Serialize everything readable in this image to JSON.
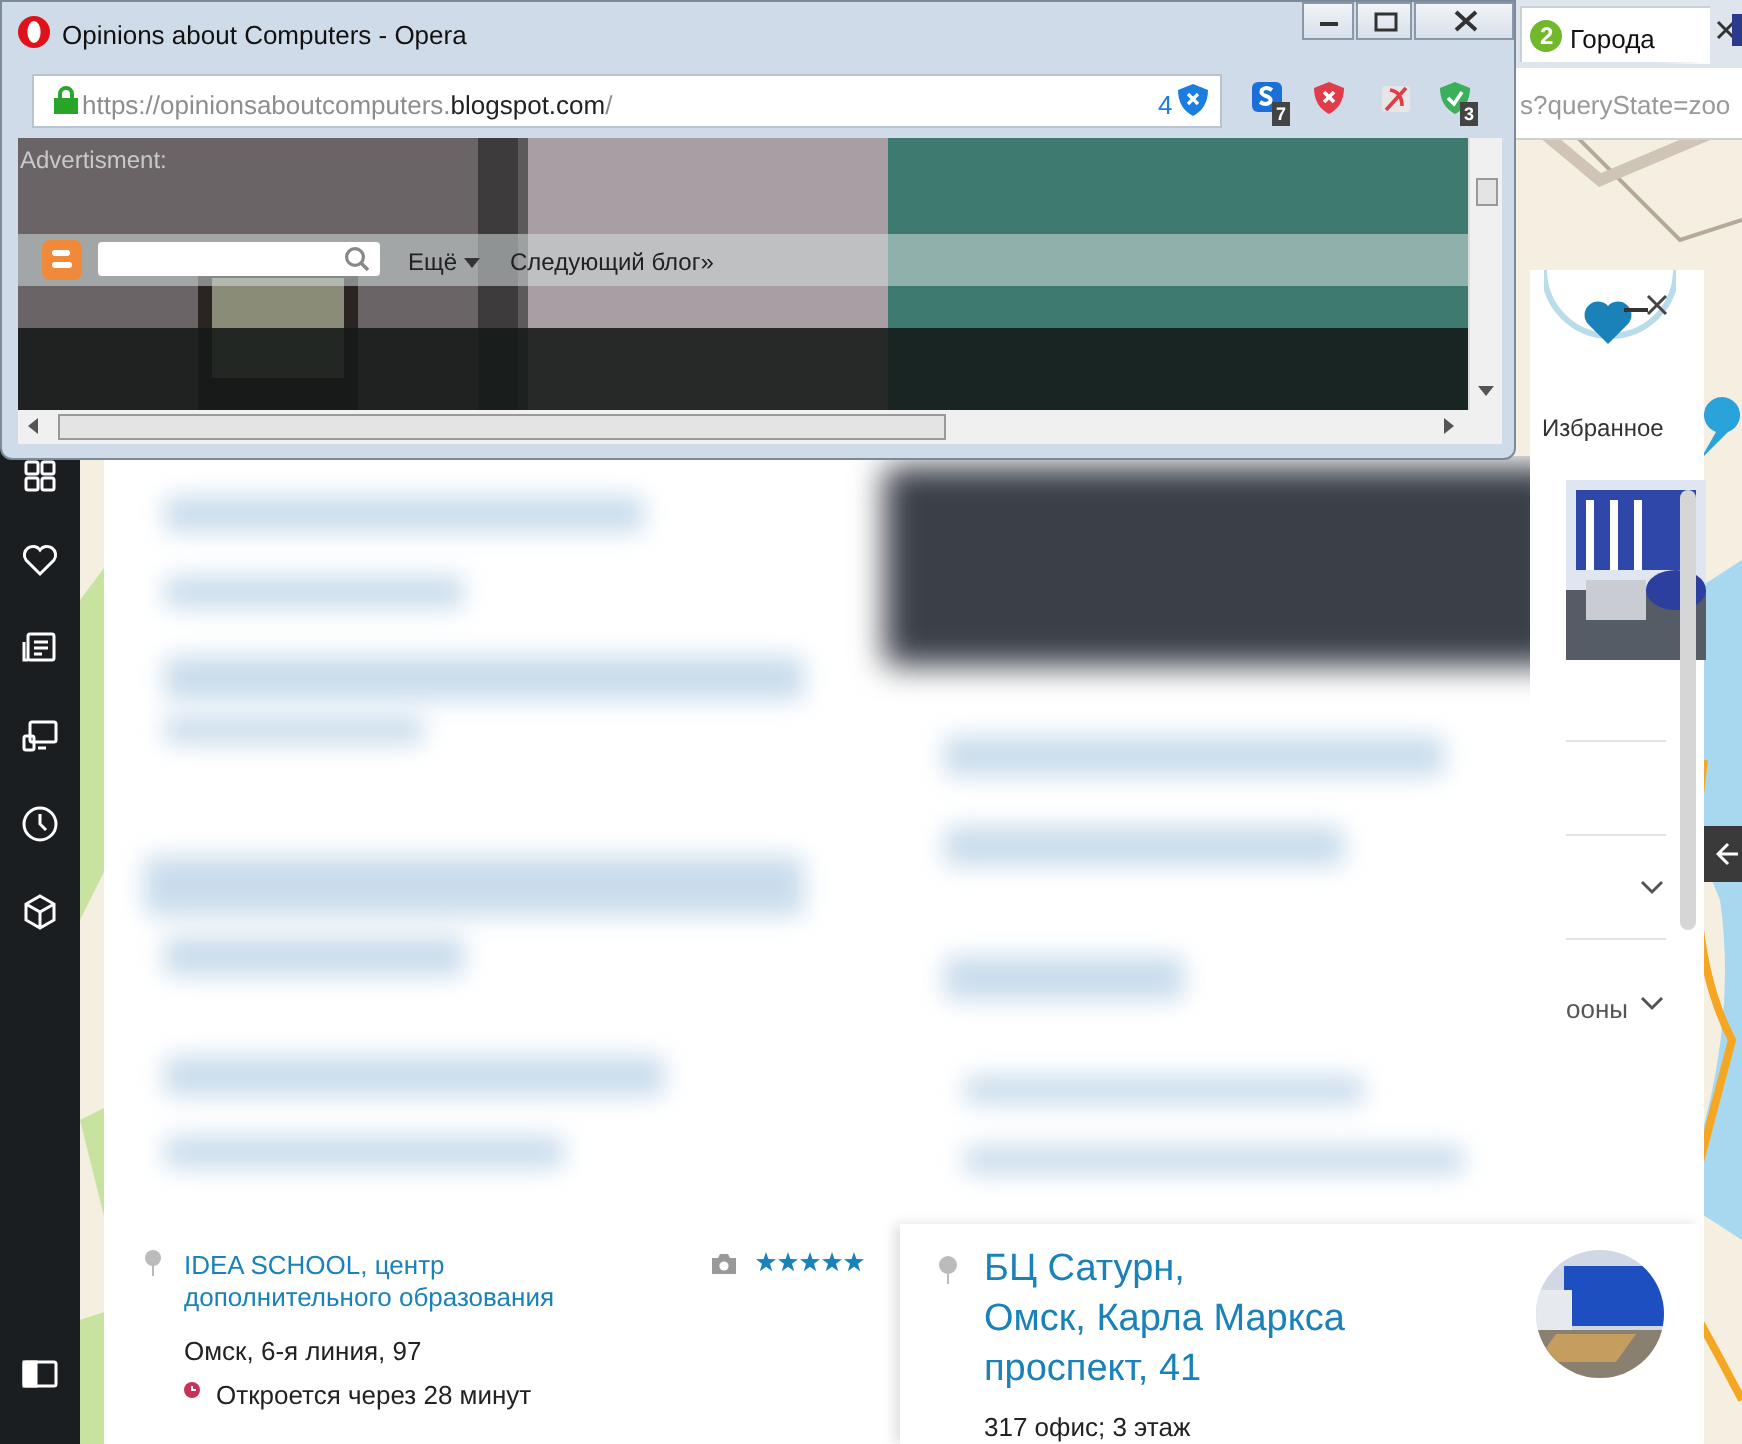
{
  "popup_window": {
    "title": "Opinions about Computers - Opera",
    "url": [
      {
        "text": "https://opinionsaboutcomputers.",
        "emphasis": false
      },
      {
        "text": "blogspot.com",
        "emphasis": true
      },
      {
        "text": "/",
        "emphasis": false
      }
    ],
    "blocked_count": "4",
    "extensions": [
      {
        "kind": "s",
        "badge": "7"
      },
      {
        "kind": "block"
      },
      {
        "kind": "mute"
      },
      {
        "kind": "check",
        "badge": "3"
      }
    ],
    "page": {
      "ad_label": "Advertisment:",
      "nav": [
        {
          "label": "Ещё",
          "dropdown": true
        },
        {
          "label": "Следующий блог»",
          "dropdown": false
        }
      ]
    }
  },
  "background_tab": {
    "badge": "2",
    "title": "Города",
    "url_fragment": "s?queryState=zoo"
  },
  "favorites": {
    "label": "Избранное"
  },
  "side_panel": {
    "partial_label": "ооны"
  },
  "result": {
    "title": "IDEA SCHOOL, центр дополнительного образования",
    "stars": 5,
    "address": "Омск, 6-я линия, 97",
    "hours": "Откроется через 28 минут"
  },
  "detail": {
    "title_lines": [
      "БЦ Сатурн,",
      "Омск, Карла Маркса",
      "проспект, 41"
    ],
    "note": "317 офис; 3 этаж"
  }
}
